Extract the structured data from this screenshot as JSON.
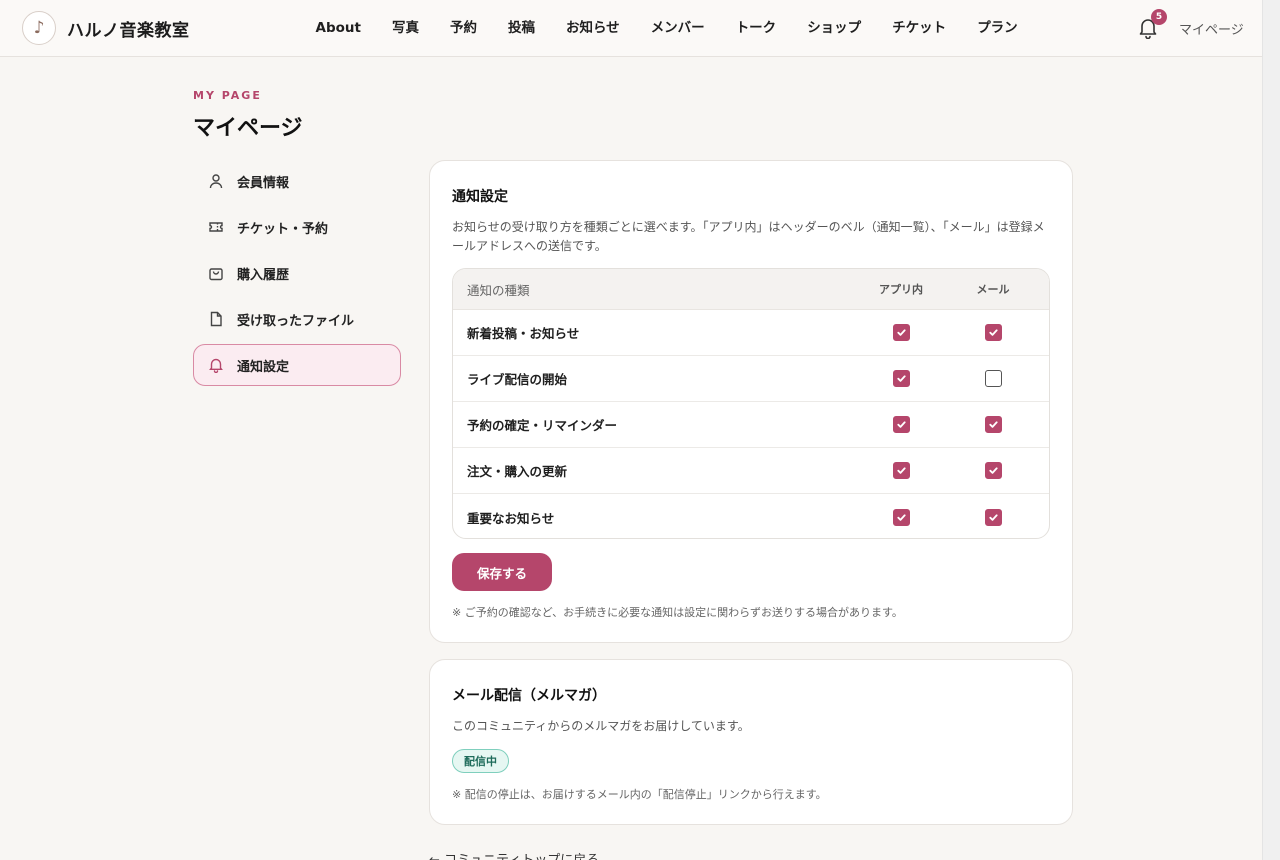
{
  "header": {
    "brand": "ハルノ音楽教室",
    "logo_glyph": "♪",
    "nav": [
      "About",
      "写真",
      "予約",
      "投稿",
      "お知らせ",
      "メンバー",
      "トーク",
      "ショップ",
      "チケット",
      "プラン"
    ],
    "notification_count": "5",
    "mypage_link": "マイページ"
  },
  "page": {
    "eyebrow": "MY PAGE",
    "title": "マイページ"
  },
  "sidebar": {
    "items": [
      {
        "label": "会員情報",
        "icon": "user-icon"
      },
      {
        "label": "チケット・予約",
        "icon": "ticket-icon"
      },
      {
        "label": "購入履歴",
        "icon": "shopping-bag-icon"
      },
      {
        "label": "受け取ったファイル",
        "icon": "file-icon"
      },
      {
        "label": "通知設定",
        "icon": "bell-icon",
        "active": true
      }
    ]
  },
  "notify": {
    "title": "通知設定",
    "description": "お知らせの受け取り方を種類ごとに選べます。「アプリ内」はヘッダーのベル（通知一覧）、「メール」は登録メールアドレスへの送信です。",
    "columns": {
      "type": "通知の種類",
      "app": "アプリ内",
      "mail": "メール"
    },
    "rows": [
      {
        "label": "新着投稿・お知らせ",
        "app": true,
        "mail": true
      },
      {
        "label": "ライブ配信の開始",
        "app": true,
        "mail": false
      },
      {
        "label": "予約の確定・リマインダー",
        "app": true,
        "mail": true
      },
      {
        "label": "注文・購入の更新",
        "app": true,
        "mail": true
      },
      {
        "label": "重要なお知らせ",
        "app": true,
        "mail": true
      }
    ],
    "save_label": "保存する",
    "note": "※ ご予約の確認など、お手続きに必要な通知は設定に関わらずお送りする場合があります。"
  },
  "mail": {
    "title": "メール配信（メルマガ）",
    "description": "このコミュニティからのメルマガをお届けしています。",
    "status": "配信中",
    "note": "※ 配信の停止は、お届けするメール内の「配信停止」リンクから行えます。"
  },
  "back_link": "← コミュニティトップに戻る",
  "colors": {
    "accent": "#b5466b",
    "active_bg": "#fbecf1",
    "badge_bg": "#e6f7f2",
    "badge_border": "#7fcfbd"
  }
}
